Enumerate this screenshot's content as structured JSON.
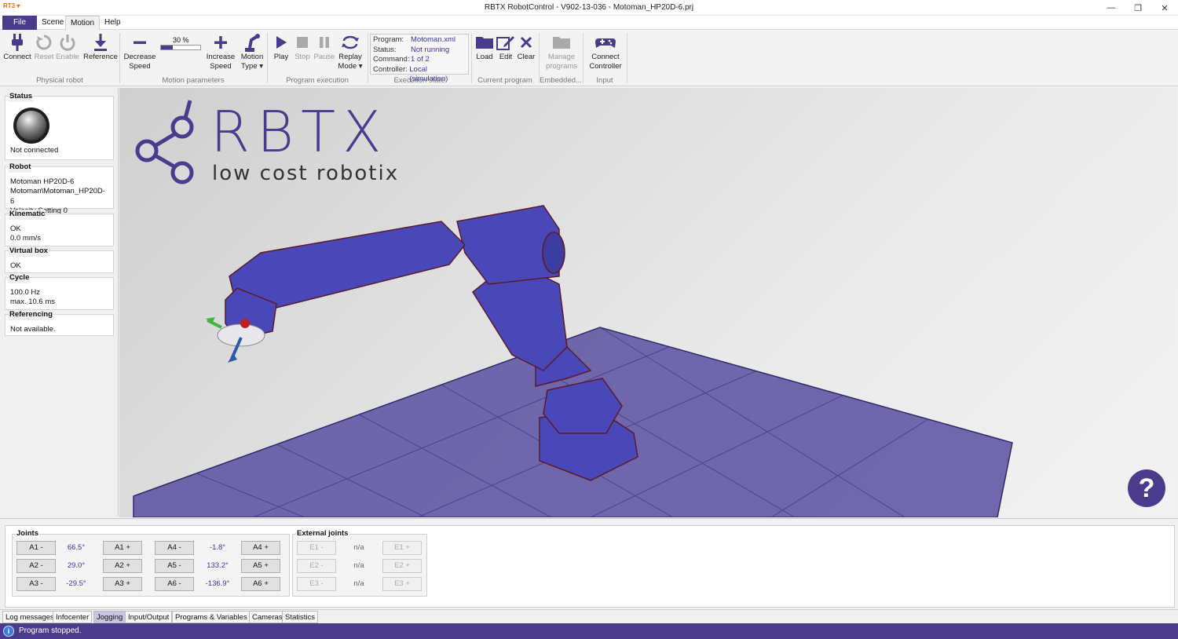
{
  "window": {
    "title": "RBTX RobotControl - V902-13-036 - Motoman_HP20D-6.prj",
    "qa_label": "RT3 ▾"
  },
  "menu": {
    "file": "File",
    "scene": "Scene",
    "motion": "Motion",
    "help": "Help"
  },
  "ribbon": {
    "connect": "Connect",
    "reset": "Reset",
    "enable": "Enable",
    "reference": "Reference",
    "physical_robot": "Physical robot",
    "decrease_speed_1": "Decrease",
    "decrease_speed_2": "Speed",
    "speed_value": "30 %",
    "speed_fraction": 0.3,
    "increase_speed_1": "Increase",
    "increase_speed_2": "Speed",
    "motion_type_1": "Motion",
    "motion_type_2": "Type ▾",
    "motion_parameters": "Motion parameters",
    "play": "Play",
    "stop": "Stop",
    "pause": "Pause",
    "replay_1": "Replay",
    "replay_2": "Mode ▾",
    "program_execution": "Program execution",
    "exec": {
      "program_k": "Program:",
      "program_v": "Motoman.xml",
      "status_k": "Status:",
      "status_v": "Not running",
      "command_k": "Command:",
      "command_v": "1 of 2",
      "controller_k": "Controller:",
      "controller_v": "Local (simulation)"
    },
    "execution_state": "Execution state",
    "load": "Load",
    "edit": "Edit",
    "clear": "Clear",
    "current_program": "Current program",
    "manage_1": "Manage",
    "manage_2": "programs",
    "embedded": "Embedded...",
    "connect_ctrl_1": "Connect",
    "connect_ctrl_2": "Controller",
    "input": "Input"
  },
  "left": {
    "status_h": "Status",
    "status_v": "Not connected",
    "robot_h": "Robot",
    "robot_1": "Motoman HP20D-6",
    "robot_2": "Motoman\\Motoman_HP20D-6",
    "robot_3": "Velocity Setting 0",
    "kin_h": "Kinematic",
    "kin_1": "OK",
    "kin_2": "0.0 mm/s",
    "vbox_h": "Virtual box",
    "vbox_1": "OK",
    "cycle_h": "Cycle",
    "cycle_1": "100.0 Hz",
    "cycle_2": "max. 10.6 ms",
    "ref_h": "Referencing",
    "ref_1": "Not available."
  },
  "viewport": {
    "logo_big": "RBTX",
    "logo_small": "low cost robotix",
    "help": "?"
  },
  "joints": {
    "title": "Joints",
    "ext_title": "External joints",
    "rows": [
      {
        "lm": "A1 -",
        "v": "66.5°",
        "lp": "A1 +",
        "rm": "A4 -",
        "rv": "-1.8°",
        "rp": "A4 +",
        "em": "E1 -",
        "ev": "n/a",
        "ep": "E1 +"
      },
      {
        "lm": "A2 -",
        "v": "29.0°",
        "lp": "A2 +",
        "rm": "A5 -",
        "rv": "133.2°",
        "rp": "A5 +",
        "em": "E2 -",
        "ev": "n/a",
        "ep": "E2 +"
      },
      {
        "lm": "A3 -",
        "v": "-29.5°",
        "lp": "A3 +",
        "rm": "A6 -",
        "rv": "-136.9°",
        "rp": "A6 +",
        "em": "E3 -",
        "ev": "n/a",
        "ep": "E3 +"
      }
    ]
  },
  "tabs": [
    "Log messages",
    "Infocenter",
    "Jogging",
    "Input/Output",
    "Programs & Variables",
    "Cameras",
    "Statistics"
  ],
  "status": {
    "text": "Program stopped.",
    "icon": "i"
  }
}
